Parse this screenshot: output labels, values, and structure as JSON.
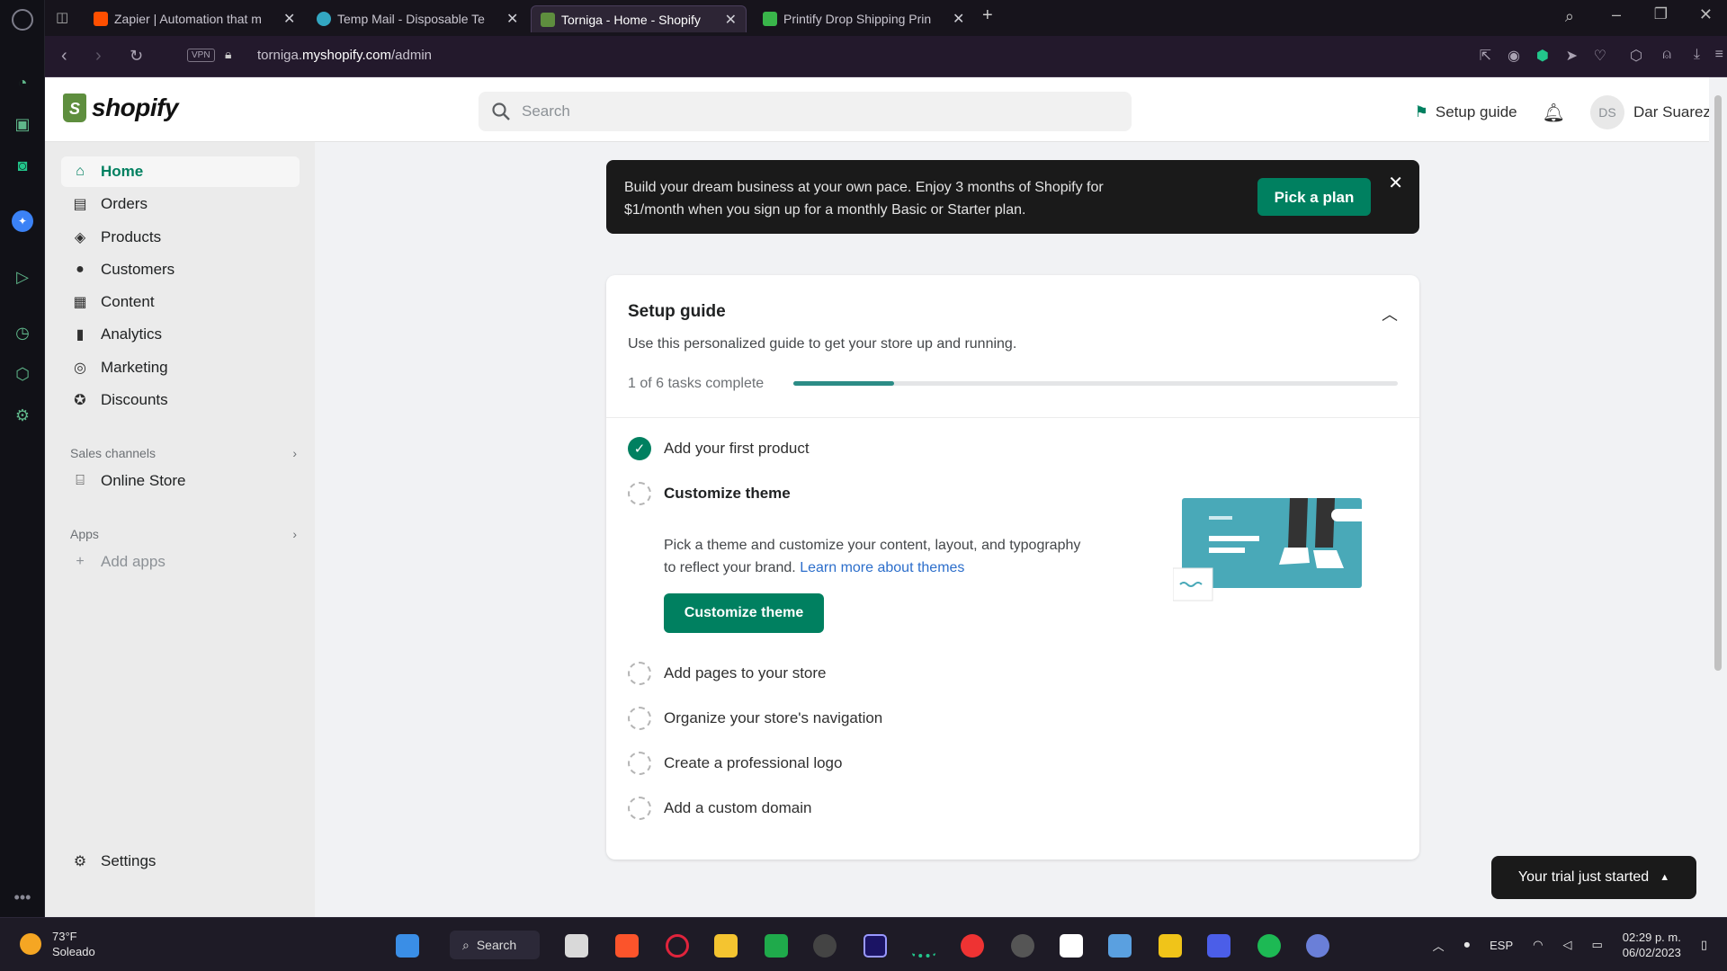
{
  "browser": {
    "tabs": [
      {
        "label": "Zapier | Automation that m",
        "color": "#ff4f00"
      },
      {
        "label": "Temp Mail - Disposable Te",
        "color": "#33a7c2"
      },
      {
        "label": "Torniga - Home - Shopify",
        "color": "#5e8e3e"
      },
      {
        "label": "Printify Drop Shipping Prin",
        "color": "#39b54a"
      }
    ],
    "new_tab": "+",
    "url_prefix": "torniga.",
    "url_domain": "myshopify.com",
    "url_path": "/admin",
    "vpn": "VPN"
  },
  "shopify": {
    "logo_text": "shopify",
    "search_placeholder": "Search",
    "setup_guide_link": "Setup guide",
    "user_initials": "DS",
    "user_name": "Dar Suarez"
  },
  "sidebar": {
    "items": [
      {
        "label": "Home",
        "icon": "home-icon"
      },
      {
        "label": "Orders",
        "icon": "orders-icon"
      },
      {
        "label": "Products",
        "icon": "tag-icon"
      },
      {
        "label": "Customers",
        "icon": "person-icon"
      },
      {
        "label": "Content",
        "icon": "content-icon"
      },
      {
        "label": "Analytics",
        "icon": "chart-icon"
      },
      {
        "label": "Marketing",
        "icon": "target-icon"
      },
      {
        "label": "Discounts",
        "icon": "discount-icon"
      }
    ],
    "sales_channels": "Sales channels",
    "online_store": "Online Store",
    "apps": "Apps",
    "add_apps": "Add apps",
    "settings": "Settings"
  },
  "banner": {
    "text": "Build your dream business at your own pace. Enjoy 3 months of Shopify for $1/month when you sign up for a monthly Basic or Starter plan.",
    "button": "Pick a plan"
  },
  "setup": {
    "title": "Setup guide",
    "subtitle": "Use this personalized guide to get your store up and running.",
    "progress_label": "1 of 6 tasks complete",
    "progress_fraction": 0.1667,
    "tasks": [
      {
        "label": "Add your first product",
        "done": true
      },
      {
        "label": "Customize theme",
        "done": false
      },
      {
        "label": "Add pages to your store",
        "done": false
      },
      {
        "label": "Organize your store's navigation",
        "done": false
      },
      {
        "label": "Create a professional logo",
        "done": false
      },
      {
        "label": "Add a custom domain",
        "done": false
      }
    ],
    "theme_desc": "Pick a theme and customize your content, layout, and typography to reflect your brand.",
    "theme_link": "Learn more about themes",
    "theme_button": "Customize theme"
  },
  "trial_button": "Your trial just started",
  "taskbar": {
    "temp": "73°F",
    "condition": "Soleado",
    "search": "Search",
    "lang": "ESP",
    "time": "02:29 p. m.",
    "date": "06/02/2023"
  },
  "colors": {
    "accent": "#008060",
    "banner": "#1a1a1a",
    "progress": "#2c8c86"
  }
}
